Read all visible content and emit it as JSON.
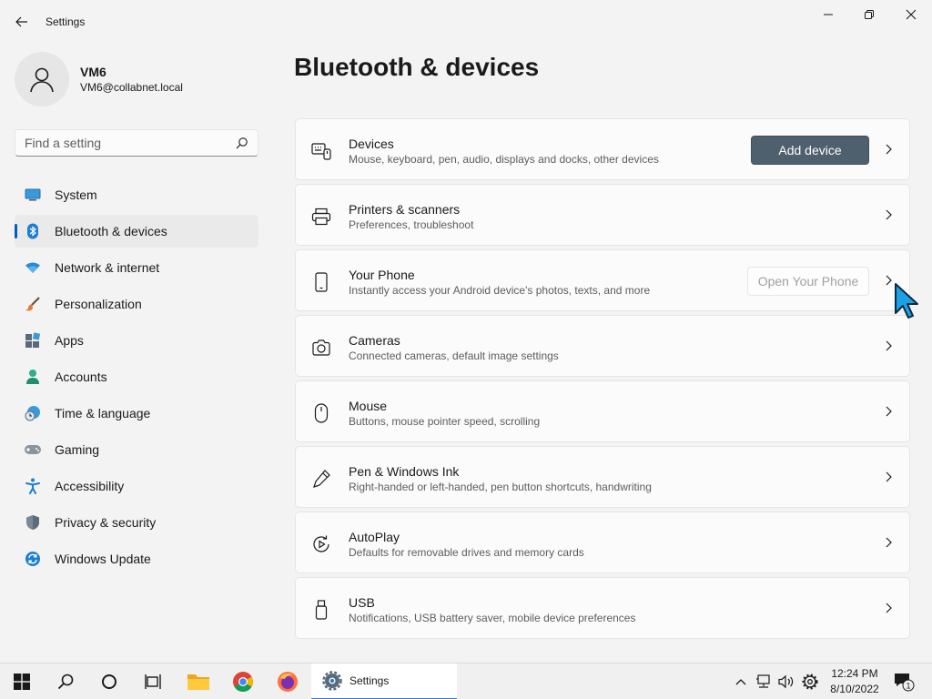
{
  "window": {
    "title": "Settings"
  },
  "user": {
    "name": "VM6",
    "email": "VM6@collabnet.local"
  },
  "search": {
    "placeholder": "Find a setting"
  },
  "nav": [
    {
      "label": "System",
      "icon": "monitor-icon"
    },
    {
      "label": "Bluetooth & devices",
      "icon": "bluetooth-icon",
      "active": true
    },
    {
      "label": "Network & internet",
      "icon": "wifi-icon"
    },
    {
      "label": "Personalization",
      "icon": "brush-icon"
    },
    {
      "label": "Apps",
      "icon": "apps-icon"
    },
    {
      "label": "Accounts",
      "icon": "person-icon"
    },
    {
      "label": "Time & language",
      "icon": "clock-globe-icon"
    },
    {
      "label": "Gaming",
      "icon": "gamepad-icon"
    },
    {
      "label": "Accessibility",
      "icon": "accessibility-icon"
    },
    {
      "label": "Privacy & security",
      "icon": "shield-icon"
    },
    {
      "label": "Windows Update",
      "icon": "update-icon"
    }
  ],
  "page": {
    "title": "Bluetooth & devices"
  },
  "cards": [
    {
      "title": "Devices",
      "subtitle": "Mouse, keyboard, pen, audio, displays and docks, other devices",
      "icon": "devices-icon",
      "button": "Add device"
    },
    {
      "title": "Printers & scanners",
      "subtitle": "Preferences, troubleshoot",
      "icon": "printer-icon"
    },
    {
      "title": "Your Phone",
      "subtitle": "Instantly access your Android device's photos, texts, and more",
      "icon": "phone-icon",
      "button": "Open Your Phone"
    },
    {
      "title": "Cameras",
      "subtitle": "Connected cameras, default image settings",
      "icon": "camera-icon"
    },
    {
      "title": "Mouse",
      "subtitle": "Buttons, mouse pointer speed, scrolling",
      "icon": "mouse-icon"
    },
    {
      "title": "Pen & Windows Ink",
      "subtitle": "Right-handed or left-handed, pen button shortcuts, handwriting",
      "icon": "pen-icon"
    },
    {
      "title": "AutoPlay",
      "subtitle": "Defaults for removable drives and memory cards",
      "icon": "autoplay-icon"
    },
    {
      "title": "USB",
      "subtitle": "Notifications, USB battery saver, mobile device preferences",
      "icon": "usb-icon"
    }
  ],
  "taskbar": {
    "active_app": "Settings",
    "time": "12:24 PM",
    "date": "8/10/2022",
    "notification_count": "1"
  },
  "colors": {
    "accent": "#005fb8",
    "primary_button": "#4e5f6e"
  }
}
